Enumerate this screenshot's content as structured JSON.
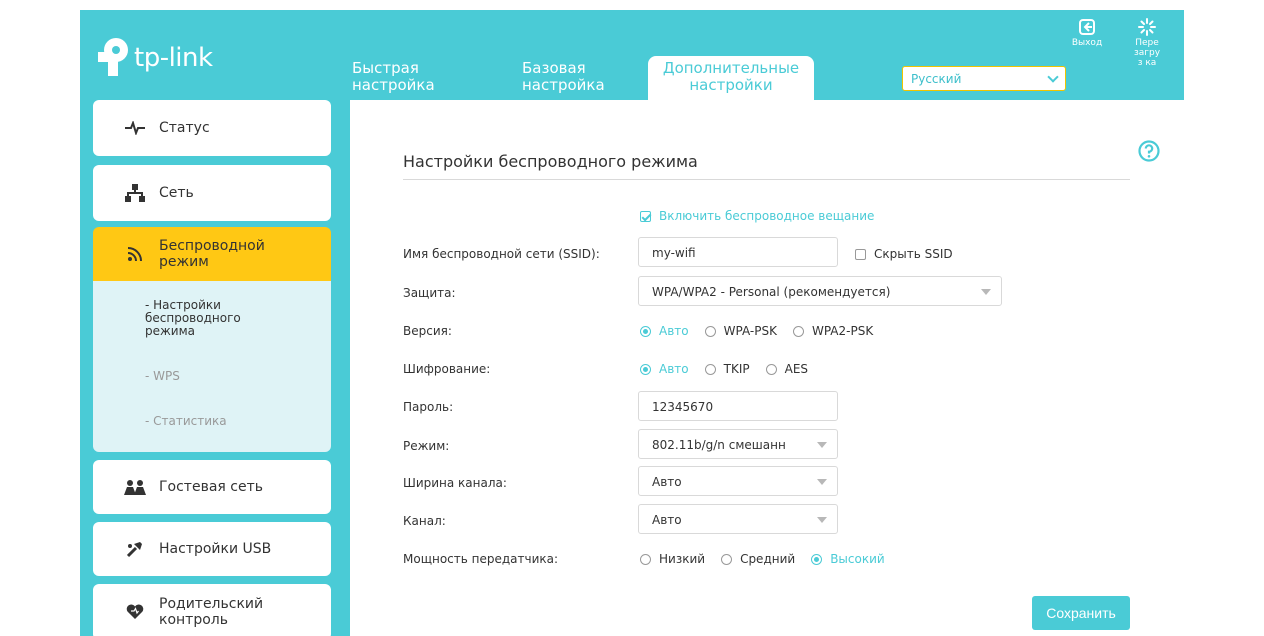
{
  "brand": {
    "logo_text": "tp-link",
    "accent_color": "#4acbd6",
    "highlight_color": "#ffc814"
  },
  "tabs": [
    {
      "label": "Быстрая настройка"
    },
    {
      "label": "Базовая настройка"
    },
    {
      "label": "Дополнительные настройки",
      "active": true
    }
  ],
  "language": {
    "selected": "Русский"
  },
  "top_actions": {
    "logout": {
      "label": "Выход",
      "icon": "logout-icon"
    },
    "reboot": {
      "label": "Пере загруз ка",
      "icon": "reboot-icon"
    }
  },
  "sidebar": {
    "items": [
      {
        "label": "Статус",
        "icon": "pulse-icon"
      },
      {
        "label": "Сеть",
        "icon": "network-icon"
      },
      {
        "label": "Беспроводной режим",
        "icon": "wifi-icon",
        "active": true
      },
      {
        "label": "Гостевая сеть",
        "icon": "guests-icon"
      },
      {
        "label": "Настройки USB",
        "icon": "usb-icon"
      },
      {
        "label": "Родительский контроль",
        "icon": "heart-icon"
      }
    ],
    "submenu": [
      {
        "label": "- Настройки беспроводного режима",
        "active": true
      },
      {
        "label": "- WPS"
      },
      {
        "label": "- Статистика"
      }
    ]
  },
  "main": {
    "title": "Настройки беспроводного режима",
    "enable_broadcast": {
      "label": "Включить беспроводное вещание",
      "checked": true
    },
    "ssid": {
      "label": "Имя беспроводной сети (SSID):",
      "value": "my-wifi"
    },
    "hide_ssid": {
      "label": "Скрыть SSID",
      "checked": false
    },
    "security": {
      "label": "Защита:",
      "value": "WPA/WPA2 - Personal (рекомендуется)"
    },
    "version": {
      "label": "Версия:",
      "options": [
        "Авто",
        "WPA-PSK",
        "WPA2-PSK"
      ],
      "selected": "Авто"
    },
    "encryption": {
      "label": "Шифрование:",
      "options": [
        "Авто",
        "TKIP",
        "AES"
      ],
      "selected": "Авто"
    },
    "password": {
      "label": "Пароль:",
      "value": "12345670"
    },
    "mode": {
      "label": "Режим:",
      "value": "802.11b/g/n смешанн"
    },
    "channel_width": {
      "label": "Ширина канала:",
      "value": "Авто"
    },
    "channel": {
      "label": "Канал:",
      "value": "Авто"
    },
    "tx_power": {
      "label": "Мощность передатчика:",
      "options": [
        "Низкий",
        "Средний",
        "Высокий"
      ],
      "selected": "Высокий"
    },
    "save_label": "Сохранить"
  }
}
